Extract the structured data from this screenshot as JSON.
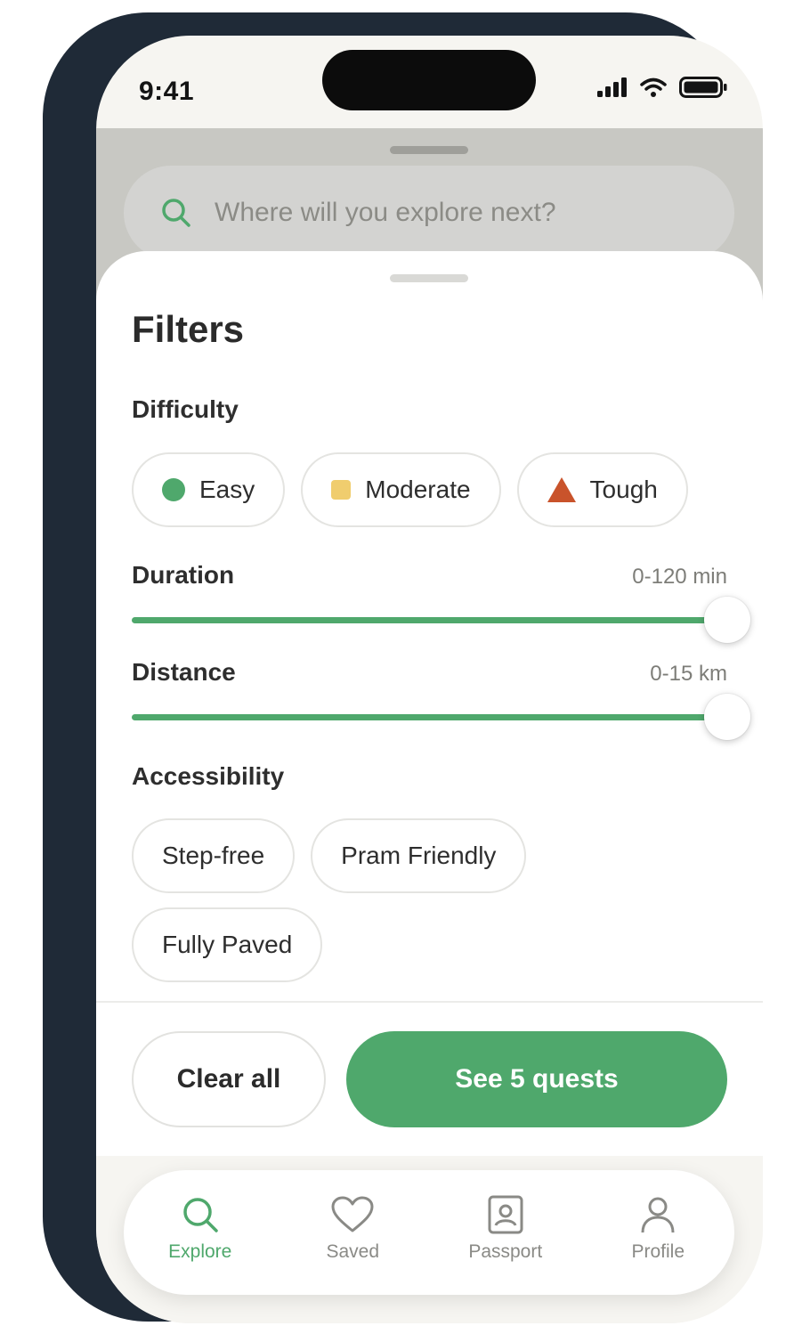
{
  "status_bar": {
    "time": "9:41"
  },
  "background": {
    "search_placeholder": "Where will you explore next?"
  },
  "filters": {
    "title": "Filters",
    "difficulty": {
      "label": "Difficulty",
      "options": [
        {
          "label": "Easy",
          "icon": "green-circle",
          "color": "#4fa86c"
        },
        {
          "label": "Moderate",
          "icon": "yellow-square",
          "color": "#f0cd6e"
        },
        {
          "label": "Tough",
          "icon": "red-triangle",
          "color": "#c9532b"
        }
      ]
    },
    "duration": {
      "label": "Duration",
      "value": "0-120 min",
      "slider_level": 1.0
    },
    "distance": {
      "label": "Distance",
      "value": "0-15 km",
      "slider_level": 1.0
    },
    "accessibility": {
      "label": "Accessibility",
      "options": [
        {
          "label": "Step-free"
        },
        {
          "label": "Pram Friendly"
        },
        {
          "label": "Fully Paved"
        }
      ]
    },
    "actions": {
      "clear_label": "Clear all",
      "see_label": "See 5 quests"
    }
  },
  "tabbar": {
    "items": [
      {
        "label": "Explore",
        "icon": "search-icon",
        "active": true
      },
      {
        "label": "Saved",
        "icon": "heart-icon",
        "active": false
      },
      {
        "label": "Passport",
        "icon": "passport-icon",
        "active": false
      },
      {
        "label": "Profile",
        "icon": "person-icon",
        "active": false
      }
    ]
  },
  "colors": {
    "accent": "#4fa86c",
    "text": "#2b2b2b",
    "muted": "#8a8a86"
  }
}
